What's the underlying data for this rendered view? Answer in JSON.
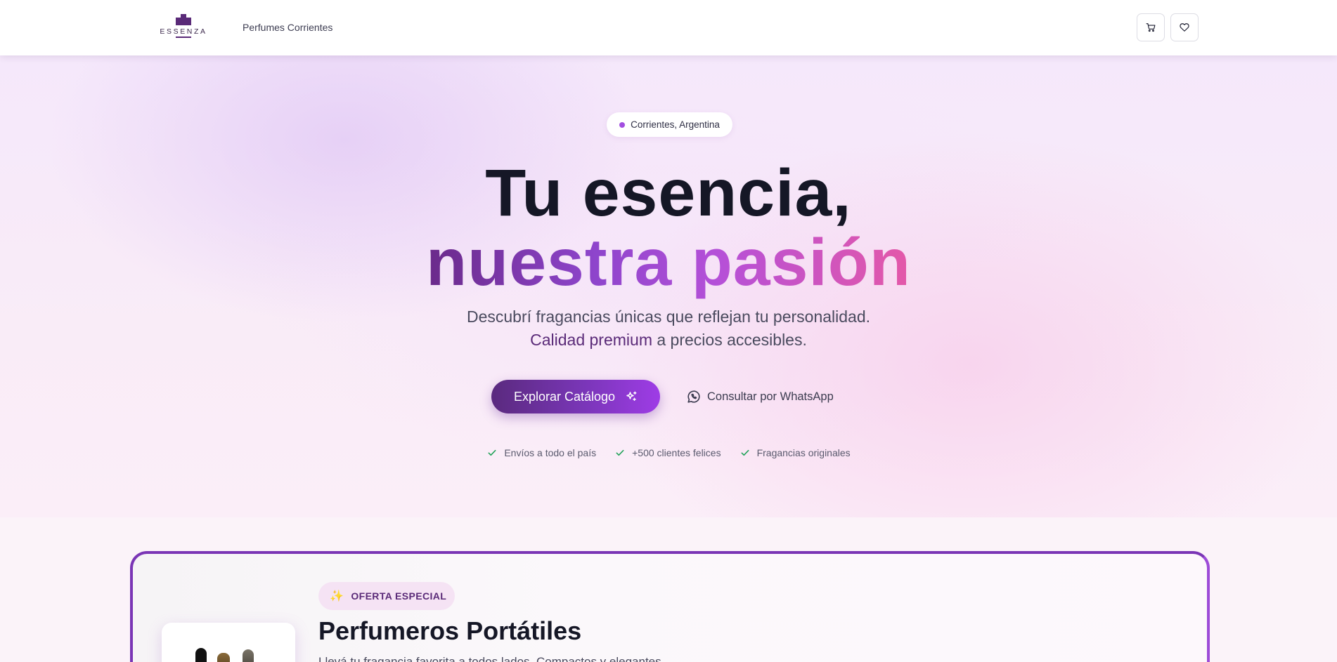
{
  "header": {
    "logo_text": "ESSENZA",
    "brand_link": "Perfumes Corrientes",
    "cart_icon": "cart-icon",
    "wishlist_icon": "heart-icon"
  },
  "hero": {
    "location": "Corrientes, Argentina",
    "title_line1": "Tu esencia,",
    "title_line2": "nuestra pasión",
    "subtitle_line1": "Descubrí fragancias únicas que reflejan tu personalidad.",
    "subtitle_line2_highlight": "Calidad premium",
    "subtitle_line2_rest": " a precios accesibles.",
    "cta_primary": "Explorar Catálogo",
    "cta_secondary": "Consultar por WhatsApp",
    "perks": [
      "Envíos a todo el país",
      "+500 clientes felices",
      "Fragancias originales"
    ]
  },
  "offer": {
    "badge": "OFERTA ESPECIAL",
    "badge_icon": "✨",
    "title": "Perfumeros Portátiles",
    "description": "Llevá tu fragancia favorita a todos lados. Compactos y elegantes."
  },
  "colors": {
    "brand_purple": "#5a2a78",
    "accent_violet": "#9e3ce6",
    "accent_pink": "#e458a8",
    "check_green": "#22a35a"
  }
}
